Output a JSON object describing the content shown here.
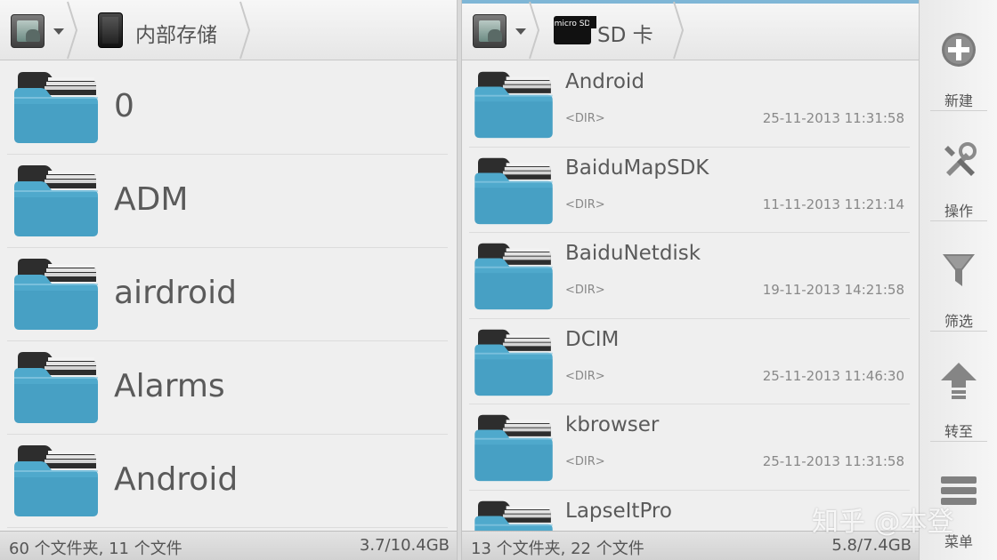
{
  "left": {
    "title": "内部存储",
    "items": [
      "0",
      "ADM",
      "airdroid",
      "Alarms",
      "Android"
    ],
    "footer": {
      "count": "60 个文件夹, 11 个文件",
      "size": "3.7/10.4GB"
    }
  },
  "right": {
    "title": "SD 卡",
    "sd_label": "micro SD",
    "items": [
      {
        "name": "Android",
        "type": "<DIR>",
        "date": "25-11-2013 11:31:58"
      },
      {
        "name": "BaiduMapSDK",
        "type": "<DIR>",
        "date": "11-11-2013 11:21:14"
      },
      {
        "name": "BaiduNetdisk",
        "type": "<DIR>",
        "date": "19-11-2013 14:21:58"
      },
      {
        "name": "DCIM",
        "type": "<DIR>",
        "date": "25-11-2013 11:46:30"
      },
      {
        "name": "kbrowser",
        "type": "<DIR>",
        "date": "25-11-2013 11:31:58"
      },
      {
        "name": "LapseItPro",
        "type": "",
        "date": ""
      }
    ],
    "footer": {
      "count": "13 个文件夹, 22 个文件",
      "size": "5.8/7.4GB"
    }
  },
  "sidebar": [
    {
      "label": "新建",
      "icon": "plus-circle-icon"
    },
    {
      "label": "操作",
      "icon": "tools-icon"
    },
    {
      "label": "筛选",
      "icon": "funnel-icon"
    },
    {
      "label": "转至",
      "icon": "arrow-up-icon"
    },
    {
      "label": "菜单",
      "icon": "menu-icon"
    }
  ],
  "watermark": "知乎 @本登",
  "colors": {
    "folder": "#4fa9cc",
    "active_strip": "#7fb6d6"
  }
}
